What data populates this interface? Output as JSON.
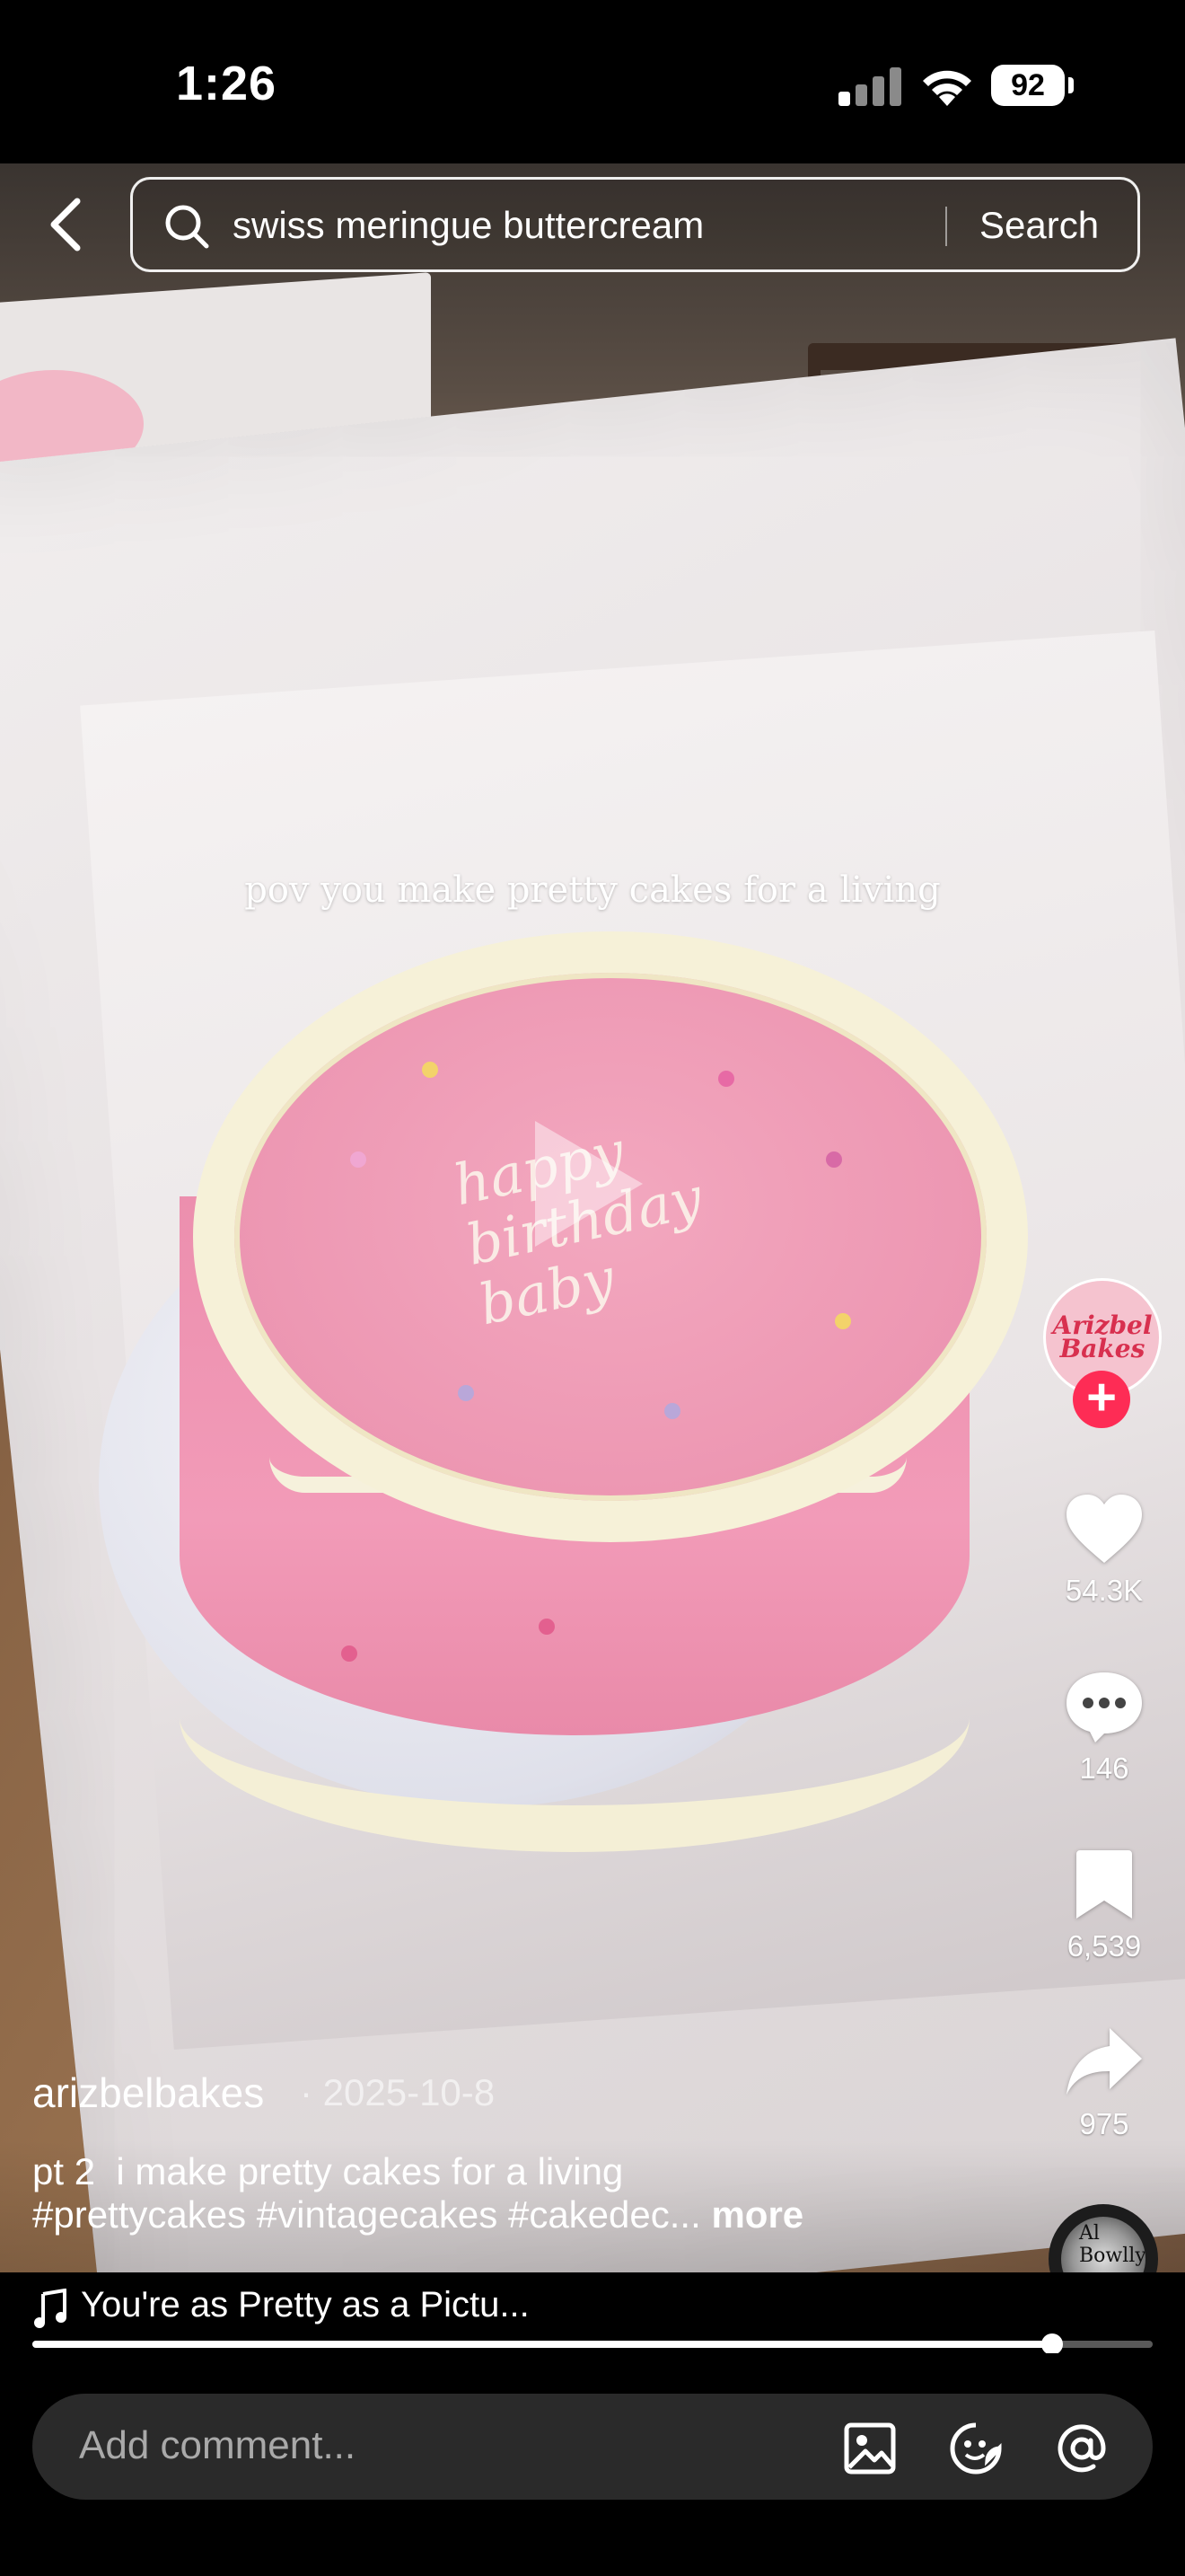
{
  "status_bar": {
    "time": "1:26",
    "battery": "92",
    "signal_bars_active": 1,
    "signal_bars_total": 4
  },
  "search": {
    "query": "swiss meringue buttercream",
    "button_label": "Search"
  },
  "video": {
    "overlay_caption": "pov you make pretty cakes for a living",
    "cake_writing": [
      "happy",
      "birthday",
      "baby"
    ],
    "accent_pink": "#ec8fae",
    "frosting_cream": "#f6f1d8"
  },
  "creator": {
    "avatar_text_line1": "Arizbel",
    "avatar_text_line2": "Bakes",
    "follow_label": "+"
  },
  "actions": {
    "likes": "54.3K",
    "comments": "146",
    "saves": "6,539",
    "shares": "975"
  },
  "post": {
    "username": "arizbelbakes",
    "date": "· 2025-10-8",
    "description": "pt 2  i make pretty cakes for a living",
    "hashtags": "#prettycakes #vintagecakes #cakedec...",
    "more_label": "more"
  },
  "music": {
    "title": "You're as Pretty as a Pictu...",
    "disc_label": "Al Bowlly"
  },
  "playback": {
    "progress_fraction": 0.91
  },
  "comment_bar": {
    "placeholder": "Add comment...",
    "icons": [
      "image-icon",
      "emoji-icon",
      "mention-icon"
    ]
  },
  "colors": {
    "follow_red": "#fe2c55",
    "background": "#000000"
  }
}
